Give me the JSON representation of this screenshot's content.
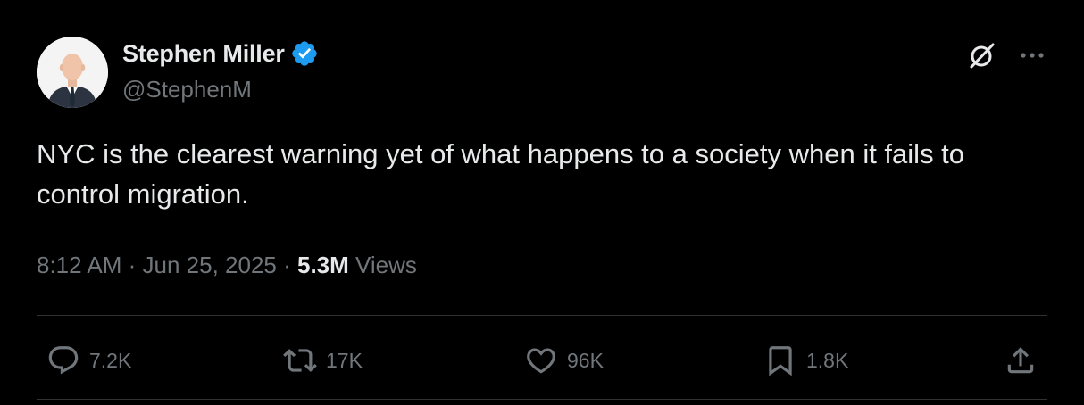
{
  "author": {
    "display_name": "Stephen Miller",
    "handle": "@StephenM",
    "verified": true,
    "verified_color": "#1d9bf0"
  },
  "icons": {
    "avatar": "profile-photo",
    "verified": "verified-badge-icon",
    "grok": "grok-icon",
    "more": "more-options-icon",
    "reply": "reply-icon",
    "retweet": "retweet-icon",
    "like": "heart-icon",
    "bookmark": "bookmark-icon",
    "share": "share-icon"
  },
  "tweet": {
    "text": "NYC is the clearest warning yet of what happens to a society when it fails to control migration."
  },
  "meta": {
    "time": "8:12 AM",
    "sep1": " · ",
    "date": "Jun 25, 2025",
    "sep2": " · ",
    "views_count": "5.3M",
    "views_label": " Views"
  },
  "actions": {
    "replies": "7.2K",
    "retweets": "17K",
    "likes": "96K",
    "bookmarks": "1.8K"
  },
  "colors": {
    "background": "#000000",
    "primary_text": "#e7e9ea",
    "secondary_text": "#71767b",
    "divider": "#2f3336"
  }
}
